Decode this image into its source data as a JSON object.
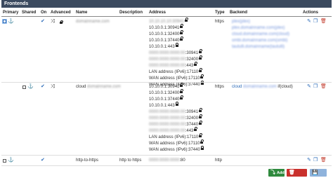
{
  "panel": {
    "title": "Frontends"
  },
  "columns": [
    "Primary",
    "Shared",
    "On",
    "Advanced",
    "Name",
    "Description",
    "Address",
    "Type",
    "Backend",
    "Actions"
  ],
  "rows": [
    {
      "name": "",
      "description": "",
      "type": "https",
      "addresses": [
        "",
        "10.10.0.1:30941",
        "10.10.0.1:32400",
        "10.10.0.1:37440",
        "10.10.0.1:443",
        "",
        "",
        "",
        "",
        "LAN address (IPv6):17110",
        "WAN address (IPv6):17110",
        "WAN address (IPv6):37440"
      ],
      "backends": [
        "",
        "",
        "",
        "",
        ""
      ]
    },
    {
      "name": "cloud",
      "description": "",
      "type": "https",
      "addresses": [
        "10.10.0.1:30941",
        "10.10.0.1:32400",
        "10.10.0.1:37440",
        "10.10.0.1:443",
        "",
        "",
        "",
        "",
        "LAN address (IPv6):17110",
        "WAN address (IPv6):17110",
        "WAN address (IPv6):37440"
      ],
      "backend_prefix": "cloud",
      "backend_suffix": " if(cloud)"
    },
    {
      "name": "http-to-https",
      "description": "http to https",
      "type": "http",
      "address_suffix": ":80"
    }
  ],
  "buttons": {
    "add": "Add",
    "delete": "Delete",
    "save": "Save"
  },
  "colors": {
    "header_bg": "#3b4a5f",
    "add": "#2f8a3e",
    "delete": "#c9302c",
    "save": "#8fb3dc",
    "link": "#2a6ab8"
  }
}
